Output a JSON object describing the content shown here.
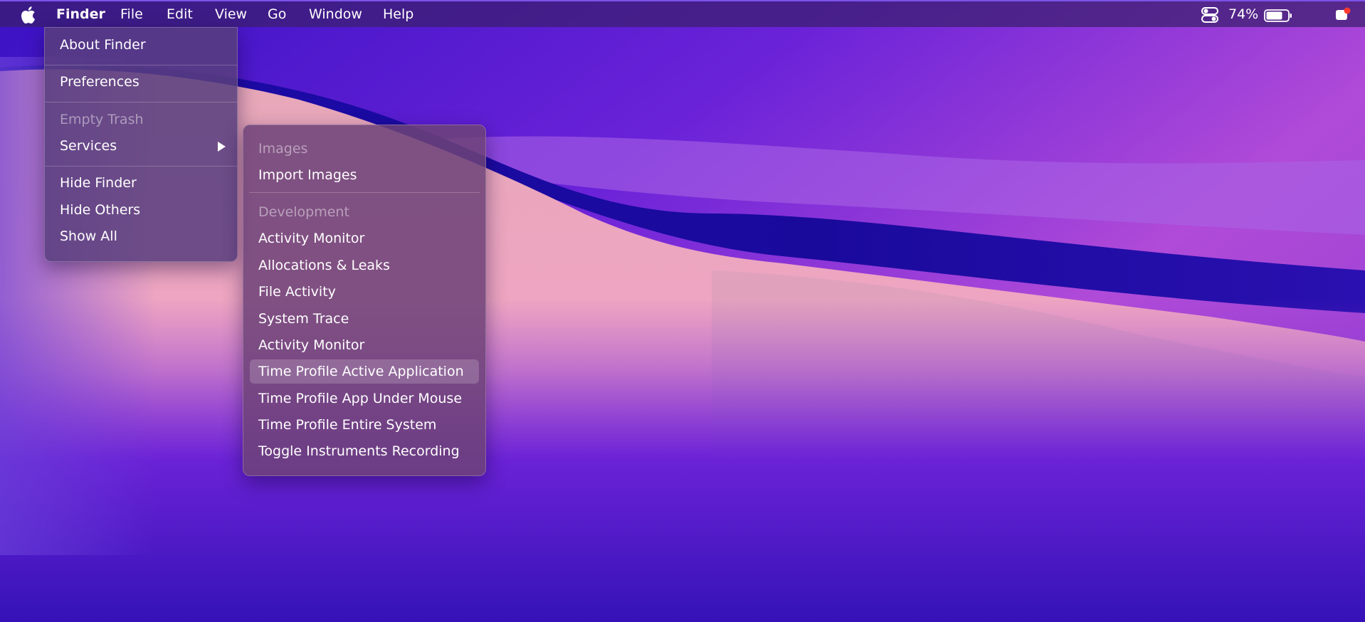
{
  "menubar": {
    "apple_icon": "apple-icon",
    "menus": [
      "Finder",
      "File",
      "Edit",
      "View",
      "Go",
      "Window",
      "Help"
    ],
    "status": {
      "control_center_icon": "control-center-icon",
      "battery_percent": "74%",
      "battery_icon": "battery-icon",
      "notification_icon": "notification-icon"
    }
  },
  "finder_menu": {
    "about": "About Finder",
    "preferences": "Preferences",
    "empty_trash": "Empty Trash",
    "services": "Services",
    "hide_finder": "Hide Finder",
    "hide_others": "Hide Others",
    "show_all": "Show All"
  },
  "services_menu": {
    "images_header": "Images",
    "import_images": "Import Images",
    "development_header": "Development",
    "items": [
      "Activity Monitor",
      "Allocations & Leaks",
      "File Activity",
      "System Trace",
      "Activity Monitor",
      "Time Profile Active Application",
      "Time Profile App Under Mouse",
      "Time Profile Entire System",
      "Toggle Instruments Recording"
    ],
    "highlighted_index": 5
  },
  "colors": {
    "accent": "#7b53e8",
    "menu_background": "#583e7e",
    "notification_badge": "#ff3b30"
  }
}
